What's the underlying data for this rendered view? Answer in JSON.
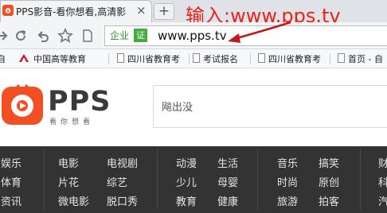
{
  "tab": {
    "title": "PPS影音-看你想看,高清影",
    "close": "×",
    "new_tab": "+"
  },
  "annotation": {
    "text": "输入:www.pps.tv",
    "color": "#e8231b"
  },
  "address_bar": {
    "cert_label": "企业",
    "cert_badge": "证",
    "url": "www.pps.tv"
  },
  "bookmarks": [
    {
      "label": "自"
    },
    {
      "label": "中国高等教育"
    },
    {
      "label": "四川省教育考"
    },
    {
      "label": "考试报名"
    },
    {
      "label": "四川省教育考"
    },
    {
      "label": "首页 - 自"
    }
  ],
  "header": {
    "logo_text": "PPS",
    "logo_sub": "看你想看",
    "search_placeholder": "飚出没",
    "brand_color": "#f25022"
  },
  "categories": {
    "row1": [
      "娱乐",
      "电影",
      "电视剧",
      "动漫",
      "生活",
      "音乐",
      "搞笑",
      "财"
    ],
    "row2": [
      "体育",
      "片花",
      "综艺",
      "少儿",
      "母婴",
      "时尚",
      "原创",
      "科"
    ],
    "row3": [
      "资讯",
      "微电影",
      "脱口秀",
      "教育",
      "健康",
      "旅游",
      "拍客",
      "汽"
    ]
  }
}
